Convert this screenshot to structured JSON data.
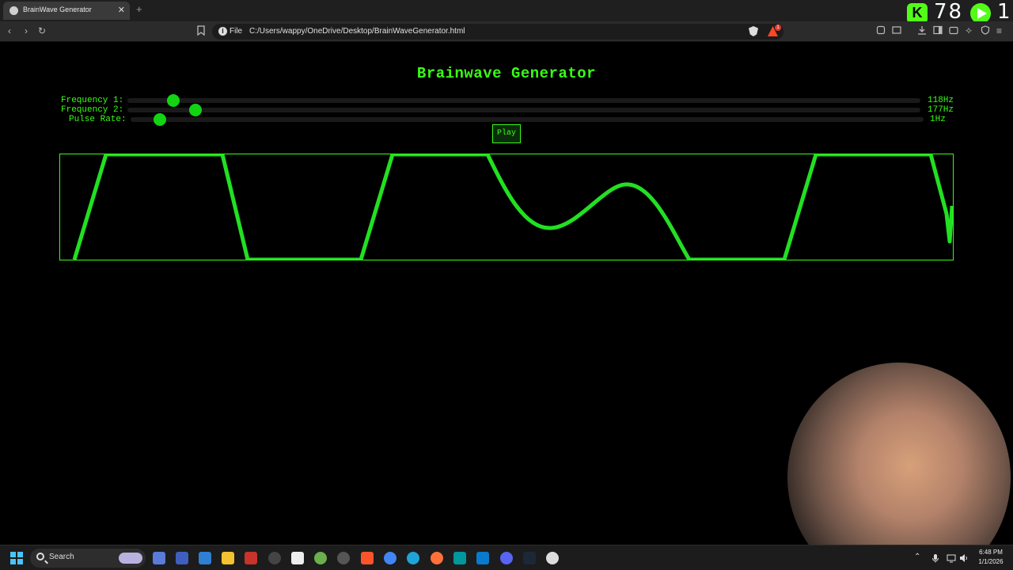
{
  "browser": {
    "tab_title": "BrainWave Generator",
    "tab_close": "✕",
    "new_tab": "+",
    "url_scheme": "File",
    "url": "C:/Users/wappy/OneDrive/Desktop/BrainWaveGenerator.html",
    "rewards_count": "1"
  },
  "overlay": {
    "kick_letter": "K",
    "kick_count": "78",
    "play_count": "1"
  },
  "app": {
    "title": "Brainwave Generator",
    "sliders": [
      {
        "label": "Frequency 1:",
        "value": "118Hz",
        "level": 0.058
      },
      {
        "label": "Frequency 2:",
        "value": "177Hz",
        "level": 0.086
      },
      {
        "label": "Pulse Rate:",
        "value": "1Hz",
        "level": 0.037
      }
    ],
    "play_label": "Play",
    "accent_color": "#39ff14"
  },
  "taskbar": {
    "search_label": "Search",
    "clock_time": "6:48 PM",
    "clock_date": "1/1/2026"
  }
}
